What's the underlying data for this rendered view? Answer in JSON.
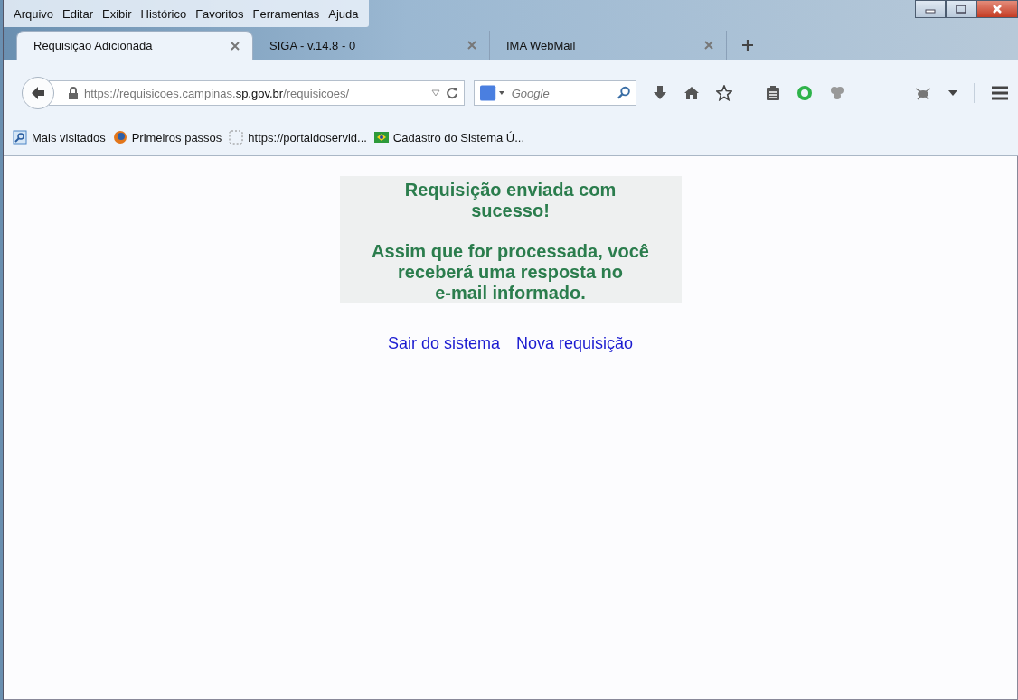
{
  "menu": [
    "Arquivo",
    "Editar",
    "Exibir",
    "Histórico",
    "Favoritos",
    "Ferramentas",
    "Ajuda"
  ],
  "tabs": [
    {
      "label": "Requisição Adicionada",
      "selected": true
    },
    {
      "label": "SIGA - v.14.8 - 0",
      "selected": false
    },
    {
      "label": "IMA WebMail",
      "selected": false
    }
  ],
  "address_bar": {
    "url": "https://requisicoes.campinas.**sp.gov.br**/requisicoes/"
  },
  "search": {
    "placeholder": "Google"
  },
  "bookmarks": [
    {
      "label": "Mais visitados",
      "kind": "search"
    },
    {
      "label": "Primeiros passos",
      "kind": "globe"
    },
    {
      "label": "https://portaldoservid...",
      "kind": "blank"
    },
    {
      "label": "Cadastro do Sistema Ú...",
      "kind": "flag"
    }
  ],
  "message": {
    "paragraphs": [
      [
        "Requisição enviada com",
        "sucesso!"
      ],
      [
        "Assim que for processada, você",
        "receberá uma resposta no",
        "e-mail informado."
      ]
    ]
  },
  "links": [
    "Sair do sistema",
    "Nova requisição"
  ]
}
